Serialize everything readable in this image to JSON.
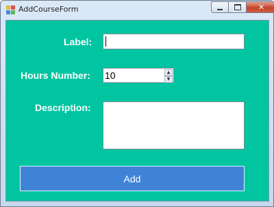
{
  "window": {
    "title": "AddCourseForm",
    "icon": "winforms-app-icon",
    "controls": {
      "minimize": "minimize-icon",
      "maximize": "maximize-icon",
      "close_label": "✕"
    }
  },
  "form": {
    "background_color": "#00c5a0",
    "label_field": {
      "label": "Label:",
      "value": ""
    },
    "hours_field": {
      "label": "Hours Number:",
      "value": "10"
    },
    "description_field": {
      "label": "Description:",
      "value": ""
    },
    "add_button": {
      "label": "Add",
      "color": "#3f83d6"
    }
  }
}
